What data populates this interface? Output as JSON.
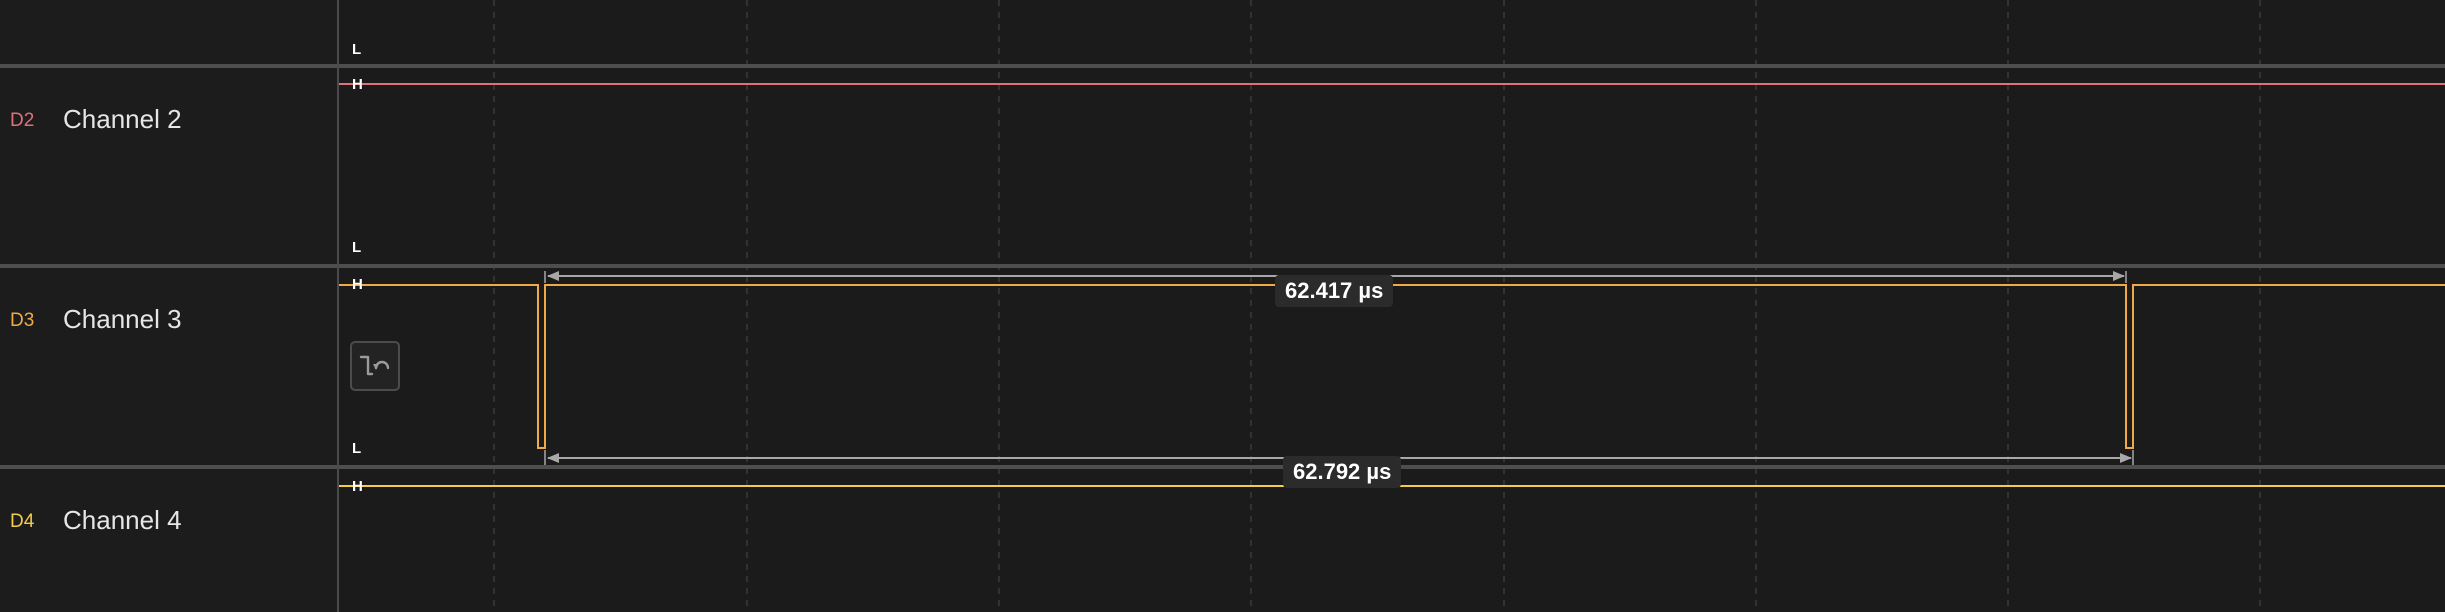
{
  "colors": {
    "background": "#1b1b1c",
    "grid": "#3a3a3c",
    "separator": "#4e4e50",
    "channel2": "#e0707c",
    "channel3": "#f0a946",
    "channel4": "#f3cc4a",
    "measure_arrow": "#a8a8a8"
  },
  "levels": {
    "low": "L",
    "high": "H"
  },
  "channels": [
    {
      "id": "D2",
      "name": "Channel 2",
      "color_key": "channel2"
    },
    {
      "id": "D3",
      "name": "Channel 3",
      "color_key": "channel3"
    },
    {
      "id": "D4",
      "name": "Channel 4",
      "color_key": "channel4"
    }
  ],
  "measurements": {
    "pulse_width": "62.417 µs",
    "period": "62.792 µs"
  },
  "icons": {
    "trigger": "falling-edge-trigger-icon"
  }
}
